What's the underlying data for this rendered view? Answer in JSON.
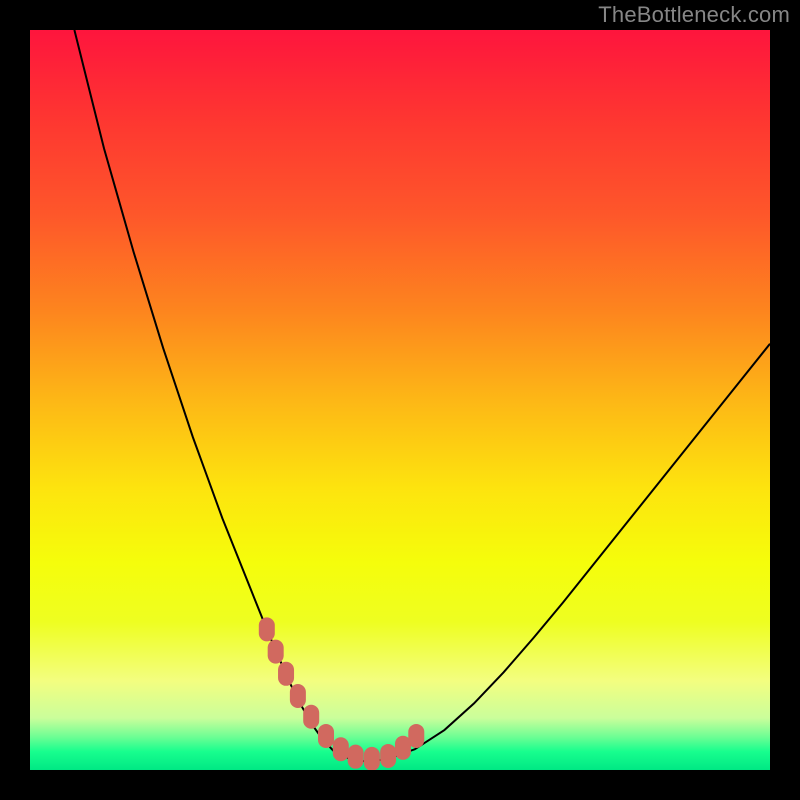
{
  "watermark": "TheBottleneck.com",
  "colors": {
    "frame": "#000000",
    "curve": "#000000",
    "marker_fill": "#d1695f",
    "marker_stroke": "#d1695f",
    "gradient_stops": [
      {
        "offset": 0.0,
        "color": "#fe153d"
      },
      {
        "offset": 0.12,
        "color": "#fe3631"
      },
      {
        "offset": 0.25,
        "color": "#fe572a"
      },
      {
        "offset": 0.38,
        "color": "#fd851e"
      },
      {
        "offset": 0.5,
        "color": "#fdb716"
      },
      {
        "offset": 0.62,
        "color": "#fde40e"
      },
      {
        "offset": 0.72,
        "color": "#f5fd0b"
      },
      {
        "offset": 0.8,
        "color": "#eefe21"
      },
      {
        "offset": 0.88,
        "color": "#f3fe80"
      },
      {
        "offset": 0.93,
        "color": "#cafe9b"
      },
      {
        "offset": 0.955,
        "color": "#6efe94"
      },
      {
        "offset": 0.975,
        "color": "#18fe8e"
      },
      {
        "offset": 1.0,
        "color": "#00e884"
      }
    ]
  },
  "chart_data": {
    "type": "line",
    "title": "",
    "xlabel": "",
    "ylabel": "",
    "xlim": [
      0,
      100
    ],
    "ylim": [
      0,
      100
    ],
    "series": [
      {
        "name": "bottleneck-curve",
        "x": [
          6,
          8,
          10,
          12,
          14,
          16,
          18,
          20,
          22,
          24,
          26,
          28,
          30,
          32,
          33.5,
          35,
          36.5,
          38,
          39.5,
          41,
          43,
          45,
          48,
          52,
          56,
          60,
          64,
          68,
          72,
          76,
          80,
          84,
          88,
          92,
          96,
          100
        ],
        "y": [
          100,
          92,
          84,
          77,
          70,
          63.5,
          57,
          51,
          45,
          39.5,
          34,
          29,
          24,
          19,
          15.5,
          12,
          9,
          6.3,
          4.2,
          2.6,
          1.6,
          1.2,
          1.4,
          2.8,
          5.4,
          9.0,
          13.2,
          17.8,
          22.6,
          27.6,
          32.6,
          37.6,
          42.6,
          47.6,
          52.6,
          57.6
        ]
      }
    ],
    "markers": {
      "name": "optimal-region",
      "x": [
        32.0,
        33.2,
        34.6,
        36.2,
        38.0,
        40.0,
        42.0,
        44.0,
        46.2,
        48.4,
        50.4,
        52.2
      ],
      "y": [
        19.0,
        16.0,
        13.0,
        10.0,
        7.2,
        4.6,
        2.8,
        1.8,
        1.5,
        1.9,
        3.0,
        4.6
      ]
    }
  }
}
